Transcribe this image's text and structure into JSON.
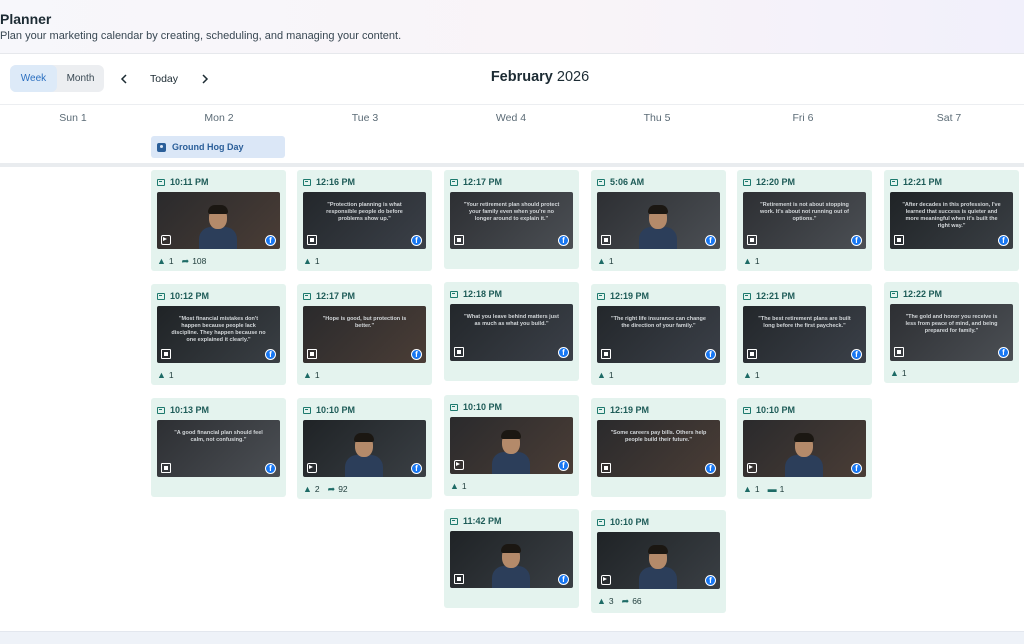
{
  "header": {
    "title": "Planner",
    "subtitle": "Plan your marketing calendar by creating, scheduling, and managing your content."
  },
  "toolbar": {
    "week_label": "Week",
    "month_label": "Month",
    "today_label": "Today",
    "month_name": "February",
    "year": "2026"
  },
  "days": [
    "Sun 1",
    "Mon 2",
    "Tue 3",
    "Wed 4",
    "Thu 5",
    "Fri 6",
    "Sat 7"
  ],
  "holiday": {
    "label": "Ground Hog Day"
  },
  "posts": [
    {
      "day": 1,
      "time": "10:11 PM",
      "type": "reel",
      "caption": "",
      "likes": "1",
      "shares": "108",
      "comments": ""
    },
    {
      "day": 1,
      "time": "10:12 PM",
      "type": "carousel",
      "caption": "\"Most financial mistakes don't happen because people lack discipline. They happen because no one explained it clearly.\"",
      "likes": "1",
      "shares": "",
      "comments": ""
    },
    {
      "day": 1,
      "time": "10:13 PM",
      "type": "carousel",
      "caption": "\"A good financial plan should feel calm, not confusing.\"",
      "likes": "",
      "shares": "",
      "comments": ""
    },
    {
      "day": 2,
      "time": "12:16 PM",
      "type": "carousel",
      "caption": "\"Protection planning is what responsible people do before problems show up.\"",
      "likes": "1",
      "shares": "",
      "comments": ""
    },
    {
      "day": 2,
      "time": "12:17 PM",
      "type": "carousel",
      "caption": "\"Hope is good, but protection is better.\"",
      "likes": "1",
      "shares": "",
      "comments": ""
    },
    {
      "day": 2,
      "time": "10:10 PM",
      "type": "reel",
      "caption": "",
      "likes": "2",
      "shares": "92",
      "comments": ""
    },
    {
      "day": 3,
      "time": "12:17 PM",
      "type": "carousel",
      "caption": "\"Your retirement plan should protect your family even when you're no longer around to explain it.\"",
      "likes": "",
      "shares": "",
      "comments": ""
    },
    {
      "day": 3,
      "time": "12:18 PM",
      "type": "carousel",
      "caption": "\"What you leave behind matters just as much as what you build.\"",
      "likes": "",
      "shares": "",
      "comments": ""
    },
    {
      "day": 3,
      "time": "10:10 PM",
      "type": "reel",
      "caption": "",
      "likes": "1",
      "shares": "",
      "comments": ""
    },
    {
      "day": 3,
      "time": "11:42 PM",
      "type": "carousel",
      "caption": "",
      "likes": "",
      "shares": "",
      "comments": ""
    },
    {
      "day": 4,
      "time": "5:06 AM",
      "type": "carousel",
      "caption": "",
      "likes": "1",
      "shares": "",
      "comments": ""
    },
    {
      "day": 4,
      "time": "12:19 PM",
      "type": "carousel",
      "caption": "\"The right life insurance can change the direction of your family.\"",
      "likes": "1",
      "shares": "",
      "comments": ""
    },
    {
      "day": 4,
      "time": "12:19 PM",
      "type": "carousel",
      "caption": "\"Some careers pay bills. Others help people build their future.\"",
      "likes": "",
      "shares": "",
      "comments": ""
    },
    {
      "day": 4,
      "time": "10:10 PM",
      "type": "reel",
      "caption": "",
      "likes": "3",
      "shares": "66",
      "comments": ""
    },
    {
      "day": 5,
      "time": "12:20 PM",
      "type": "carousel",
      "caption": "\"Retirement is not about stopping work. It's about not running out of options.\"",
      "likes": "1",
      "shares": "",
      "comments": ""
    },
    {
      "day": 5,
      "time": "12:21 PM",
      "type": "carousel",
      "caption": "\"The best retirement plans are built long before the first paycheck.\"",
      "likes": "1",
      "shares": "",
      "comments": ""
    },
    {
      "day": 5,
      "time": "10:10 PM",
      "type": "reel",
      "caption": "",
      "likes": "1",
      "shares": "",
      "comments": "1"
    },
    {
      "day": 6,
      "time": "12:21 PM",
      "type": "carousel",
      "caption": "\"After decades in this profession, I've learned that success is quieter and more meaningful when it's built the right way.\"",
      "likes": "",
      "shares": "",
      "comments": ""
    },
    {
      "day": 6,
      "time": "12:22 PM",
      "type": "carousel",
      "caption": "\"The gold and honor you receive is less from peace of mind, and being prepared for family.\"",
      "likes": "1",
      "shares": "",
      "comments": ""
    }
  ],
  "colors": {
    "card_bg": "#e4f3ee",
    "accent": "#2b6fc0",
    "holiday_bg": "#dbe7f7",
    "facebook": "#1877f2"
  }
}
